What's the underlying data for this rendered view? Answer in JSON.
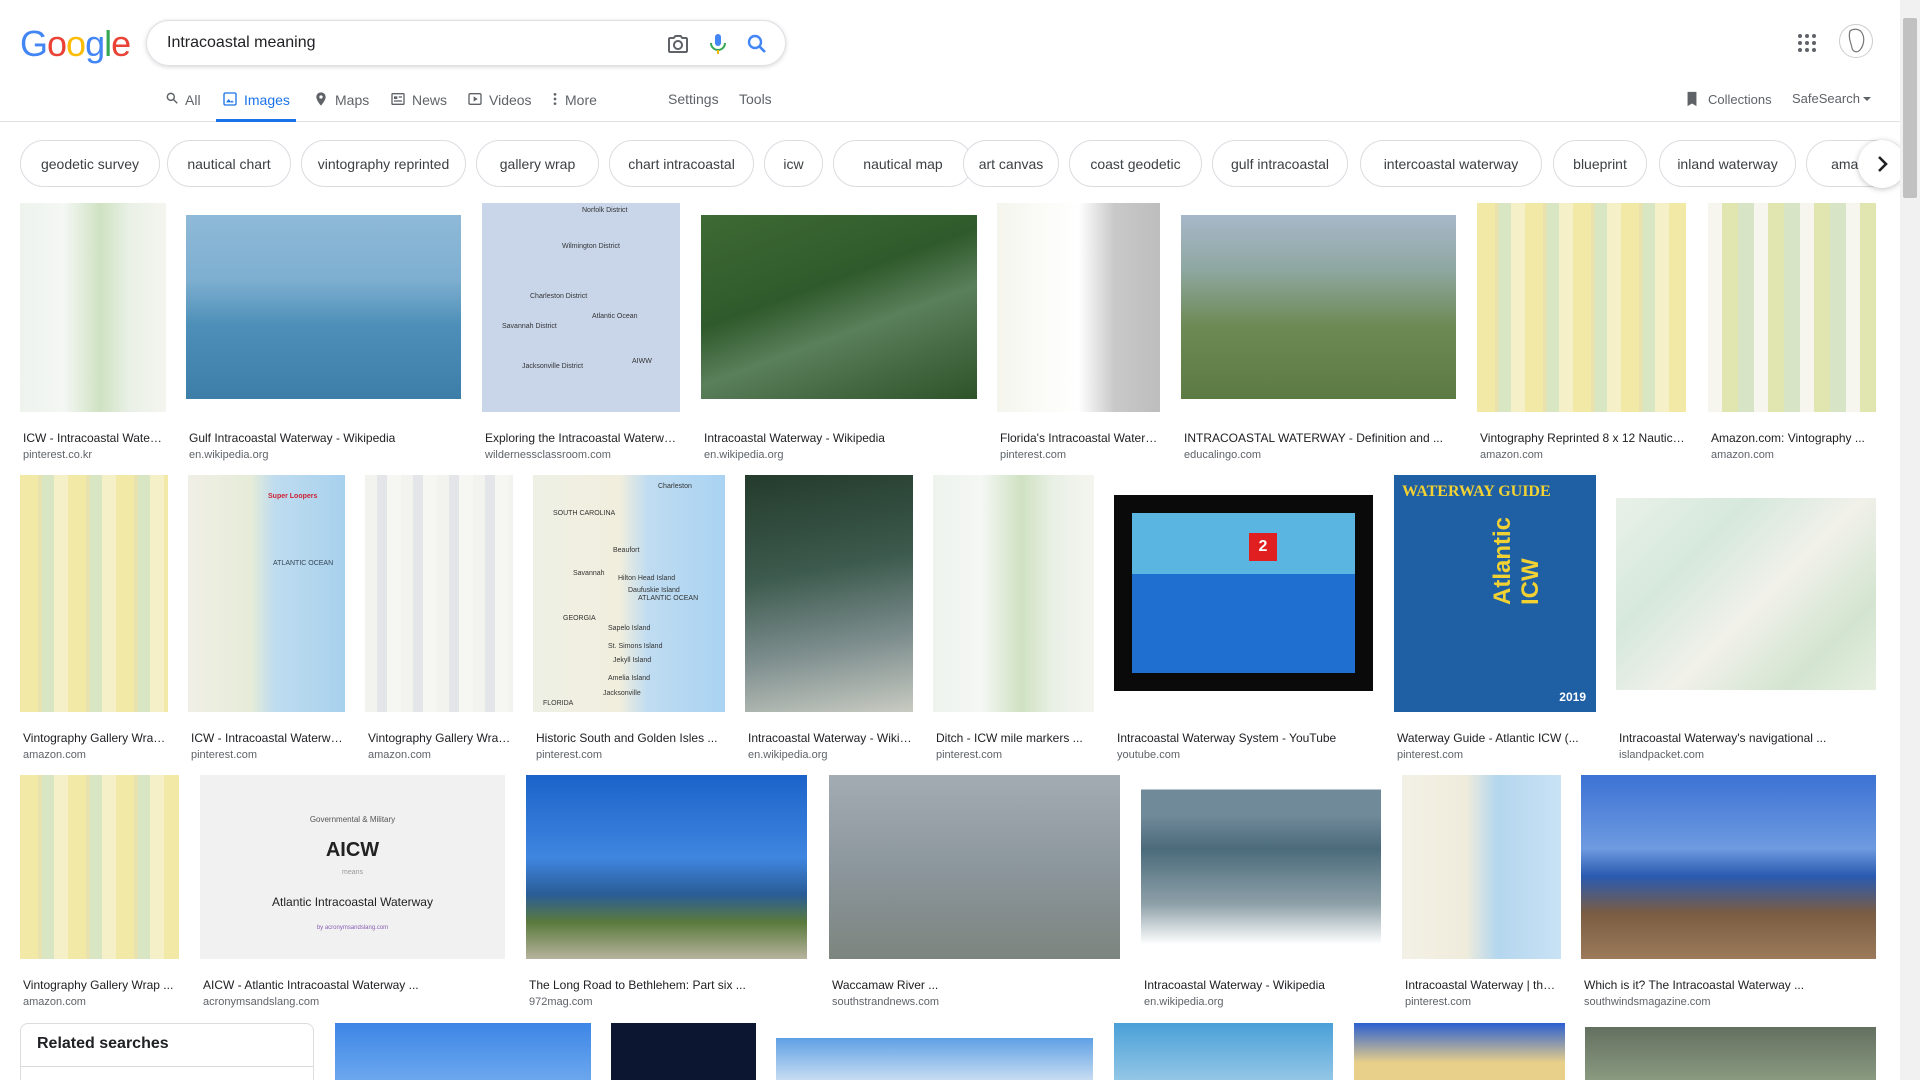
{
  "search": {
    "query": "Intracoastal meaning"
  },
  "logo": {
    "letters": [
      "G",
      "o",
      "o",
      "g",
      "l",
      "e"
    ],
    "colors": [
      "#4285F4",
      "#EA4335",
      "#FBBC05",
      "#4285F4",
      "#34A853",
      "#EA4335"
    ]
  },
  "tabs": [
    {
      "label": "All",
      "icon": "search-icon"
    },
    {
      "label": "Images",
      "icon": "image-icon",
      "active": true
    },
    {
      "label": "Maps",
      "icon": "map-icon"
    },
    {
      "label": "News",
      "icon": "news-icon"
    },
    {
      "label": "Videos",
      "icon": "video-icon"
    },
    {
      "label": "More",
      "icon": "more-vert-icon"
    }
  ],
  "tools": {
    "settings": "Settings",
    "tools": "Tools",
    "collections": "Collections",
    "safesearch": "SafeSearch"
  },
  "chips": [
    "geodetic survey",
    "nautical chart",
    "vintography reprinted",
    "gallery wrap",
    "chart intracoastal",
    "icw",
    "nautical map",
    "art canvas",
    "coast geodetic",
    "gulf intracoastal",
    "intercoastal waterway",
    "blueprint",
    "inland waterway",
    "amazon"
  ],
  "results": [
    {
      "caption": "ICW - Intracoastal Waterway ...",
      "source": "pinterest.co.kr"
    },
    {
      "caption": "Gulf Intracoastal Waterway - Wikipedia",
      "source": "en.wikipedia.org"
    },
    {
      "caption": "Exploring the Intracoastal Waterway ...",
      "source": "wildernessclassroom.com"
    },
    {
      "caption": "Intracoastal Waterway - Wikipedia",
      "source": "en.wikipedia.org"
    },
    {
      "caption": "Florida's Intracoastal Waterway ...",
      "source": "pinterest.com"
    },
    {
      "caption": "INTRACOASTAL WATERWAY - Definition and ...",
      "source": "educalingo.com"
    },
    {
      "caption": "Vintography Reprinted 8 x 12 Nautical ...",
      "source": "amazon.com"
    },
    {
      "caption": "Amazon.com: Vintography ...",
      "source": "amazon.com"
    },
    {
      "caption": "Vintography Gallery Wrap ...",
      "source": "amazon.com"
    },
    {
      "caption": "ICW - Intracoastal Waterway ...",
      "source": "pinterest.com"
    },
    {
      "caption": "Vintography Gallery Wrap ...",
      "source": "amazon.com"
    },
    {
      "caption": "Historic South and Golden Isles ...",
      "source": "pinterest.com"
    },
    {
      "caption": "Intracoastal Waterway - Wikipedia",
      "source": "en.wikipedia.org"
    },
    {
      "caption": "Ditch - ICW mile markers ...",
      "source": "pinterest.com"
    },
    {
      "caption": "Intracoastal Waterway System - YouTube",
      "source": "youtube.com"
    },
    {
      "caption": "Waterway Guide - Atlantic ICW (...",
      "source": "pinterest.com"
    },
    {
      "caption": "Intracoastal Waterway's navigational ...",
      "source": "islandpacket.com"
    },
    {
      "caption": "Vintography Gallery Wrap ...",
      "source": "amazon.com"
    },
    {
      "caption": "AICW - Atlantic Intracoastal Waterway ...",
      "source": "acronymsandslang.com"
    },
    {
      "caption": "The Long Road to Bethlehem: Part six ...",
      "source": "972mag.com"
    },
    {
      "caption": "Waccamaw River ...",
      "source": "southstrandnews.com"
    },
    {
      "caption": "Intracoastal Waterway - Wikipedia",
      "source": "en.wikipedia.org"
    },
    {
      "caption": "Intracoastal Waterway | the ...",
      "source": "pinterest.com"
    },
    {
      "caption": "Which is it? The Intracoastal Waterway ...",
      "source": "southwindsmagazine.com"
    }
  ],
  "thumb_text": {
    "aicw_category": "Governmental & Military",
    "aicw_title": "AICW",
    "aicw_means": "means",
    "aicw_full": "Atlantic Intracoastal Waterway",
    "aicw_site": "by acronymsandslang.com",
    "guide_brand": "WATERWAY GUIDE",
    "guide_title": "Atlantic ICW",
    "guide_year": "2019",
    "map_labels": [
      "Charleston",
      "SOUTH CAROLINA",
      "Beaufort",
      "Hilton Head Island",
      "Daufuskie Island",
      "Savannah",
      "ATLANTIC OCEAN",
      "GEORGIA",
      "Sapelo Island",
      "St. Simons Island",
      "Jekyll Island",
      "Amelia Island",
      "Jacksonville",
      "FLORIDA"
    ],
    "sc_labels": [
      "Norfolk District",
      "Wilmington District",
      "Charleston District",
      "Savannah District",
      "Jacksonville District",
      "Atlantic Ocean",
      "AIWW"
    ],
    "youtube_marker": "2",
    "super_loopers": "Super Loopers",
    "atlantic_ocean": "ATLANTIC OCEAN"
  },
  "related": {
    "title": "Related searches"
  }
}
